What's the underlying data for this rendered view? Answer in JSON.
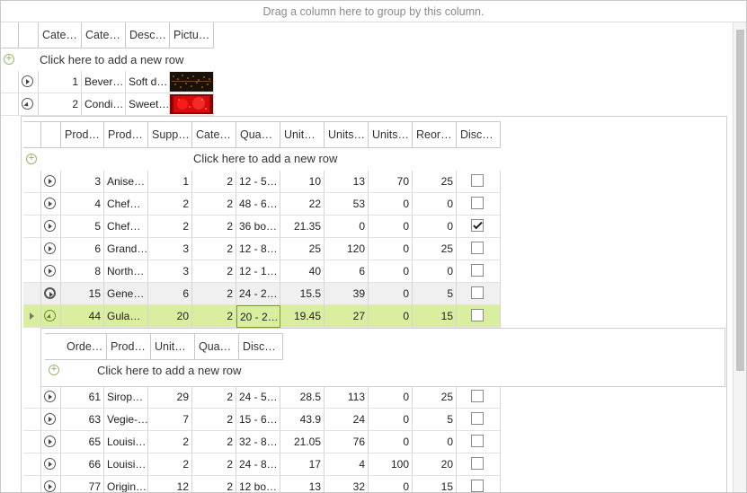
{
  "group_panel_text": "Drag a column here to group by this column.",
  "add_row_text": "Click here to add a new row",
  "colors": {
    "accent": "#d9ef9f",
    "selected_cell_border": "#7d9a2e",
    "hover_row": "#f0f0f0"
  },
  "top_grid": {
    "headers": [
      "Cate…",
      "Cate…",
      "Desc…",
      "Pictu…"
    ],
    "rows": [
      {
        "id": "1",
        "name": "Bever…",
        "desc": "Soft d…",
        "picture": "beverages-thumbnail"
      },
      {
        "id": "2",
        "name": "Condi…",
        "desc": "Sweet…",
        "picture": "condiments-thumbnail"
      }
    ]
  },
  "products": {
    "headers": [
      "Prod…",
      "Prod…",
      "Supp…",
      "Cate…",
      "Qua…",
      "Unit…",
      "Units…",
      "Units…",
      "Reor…",
      "Disc…"
    ],
    "rows_before": [
      {
        "id": "3",
        "name": "Anise…",
        "supp": "1",
        "cat": "2",
        "qty": "12 - 5…",
        "price": "10",
        "stock": "13",
        "order": "70",
        "reorder": "25",
        "disc": false
      },
      {
        "id": "4",
        "name": "Chef…",
        "supp": "2",
        "cat": "2",
        "qty": "48 - 6…",
        "price": "22",
        "stock": "53",
        "order": "0",
        "reorder": "0",
        "disc": false
      },
      {
        "id": "5",
        "name": "Chef…",
        "supp": "2",
        "cat": "2",
        "qty": "36 bo…",
        "price": "21.35",
        "stock": "0",
        "order": "0",
        "reorder": "0",
        "disc": true
      },
      {
        "id": "6",
        "name": "Grand…",
        "supp": "3",
        "cat": "2",
        "qty": "12 - 8…",
        "price": "25",
        "stock": "120",
        "order": "0",
        "reorder": "25",
        "disc": false
      },
      {
        "id": "8",
        "name": "North…",
        "supp": "3",
        "cat": "2",
        "qty": "12 - 1…",
        "price": "40",
        "stock": "6",
        "order": "0",
        "reorder": "0",
        "disc": false
      },
      {
        "id": "15",
        "name": "Gene…",
        "supp": "6",
        "cat": "2",
        "qty": "24 - 2…",
        "price": "15.5",
        "stock": "39",
        "order": "0",
        "reorder": "5",
        "disc": false
      },
      {
        "id": "44",
        "name": "Gula…",
        "supp": "20",
        "cat": "2",
        "qty": "20 - 2…",
        "price": "19.45",
        "stock": "27",
        "order": "0",
        "reorder": "15",
        "disc": false
      }
    ],
    "rows_after": [
      {
        "id": "61",
        "name": "Sirop…",
        "supp": "29",
        "cat": "2",
        "qty": "24 - 5…",
        "price": "28.5",
        "stock": "113",
        "order": "0",
        "reorder": "25",
        "disc": false
      },
      {
        "id": "63",
        "name": "Vegie-…",
        "supp": "7",
        "cat": "2",
        "qty": "15 - 6…",
        "price": "43.9",
        "stock": "24",
        "order": "0",
        "reorder": "5",
        "disc": false
      },
      {
        "id": "65",
        "name": "Louisi…",
        "supp": "2",
        "cat": "2",
        "qty": "32 - 8…",
        "price": "21.05",
        "stock": "76",
        "order": "0",
        "reorder": "0",
        "disc": false
      },
      {
        "id": "66",
        "name": "Louisi…",
        "supp": "2",
        "cat": "2",
        "qty": "24 - 8…",
        "price": "17",
        "stock": "4",
        "order": "100",
        "reorder": "20",
        "disc": false
      },
      {
        "id": "77",
        "name": "Origin…",
        "supp": "12",
        "cat": "2",
        "qty": "12 bo…",
        "price": "13",
        "stock": "32",
        "order": "0",
        "reorder": "15",
        "disc": false
      }
    ]
  },
  "order_details": {
    "headers": [
      "Orde…",
      "Prod…",
      "Unit…",
      "Qua…",
      "Disc…"
    ]
  }
}
